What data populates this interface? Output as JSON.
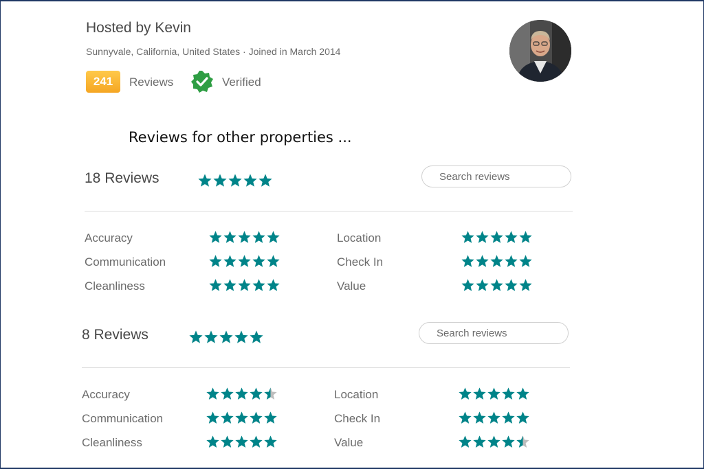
{
  "host": {
    "title": "Hosted by Kevin",
    "subtitle": "Sunnyvale, California, United States · Joined in March 2014",
    "review_count_badge": "241",
    "reviews_label": "Reviews",
    "verified_label": "Verified",
    "verified_icon": "verified-check-icon",
    "avatar_icon": "avatar"
  },
  "section_heading": "Reviews for other properties ...",
  "colors": {
    "star": "#008489",
    "star_empty": "#bdbdbd",
    "badge": "#f5a623",
    "verified": "#2f9e44"
  },
  "review_blocks": [
    {
      "count_label": "18 Reviews",
      "overall_rating": 5,
      "search_placeholder": "Search reviews",
      "categories": [
        {
          "label": "Accuracy",
          "rating": 5
        },
        {
          "label": "Location",
          "rating": 5
        },
        {
          "label": "Communication",
          "rating": 5
        },
        {
          "label": "Check In",
          "rating": 5
        },
        {
          "label": "Cleanliness",
          "rating": 5
        },
        {
          "label": "Value",
          "rating": 5
        }
      ]
    },
    {
      "count_label": "8 Reviews",
      "overall_rating": 5,
      "search_placeholder": "Search reviews",
      "categories": [
        {
          "label": "Accuracy",
          "rating": 4.5
        },
        {
          "label": "Location",
          "rating": 5
        },
        {
          "label": "Communication",
          "rating": 5
        },
        {
          "label": "Check In",
          "rating": 5
        },
        {
          "label": "Cleanliness",
          "rating": 5
        },
        {
          "label": "Value",
          "rating": 4.5
        }
      ]
    }
  ]
}
